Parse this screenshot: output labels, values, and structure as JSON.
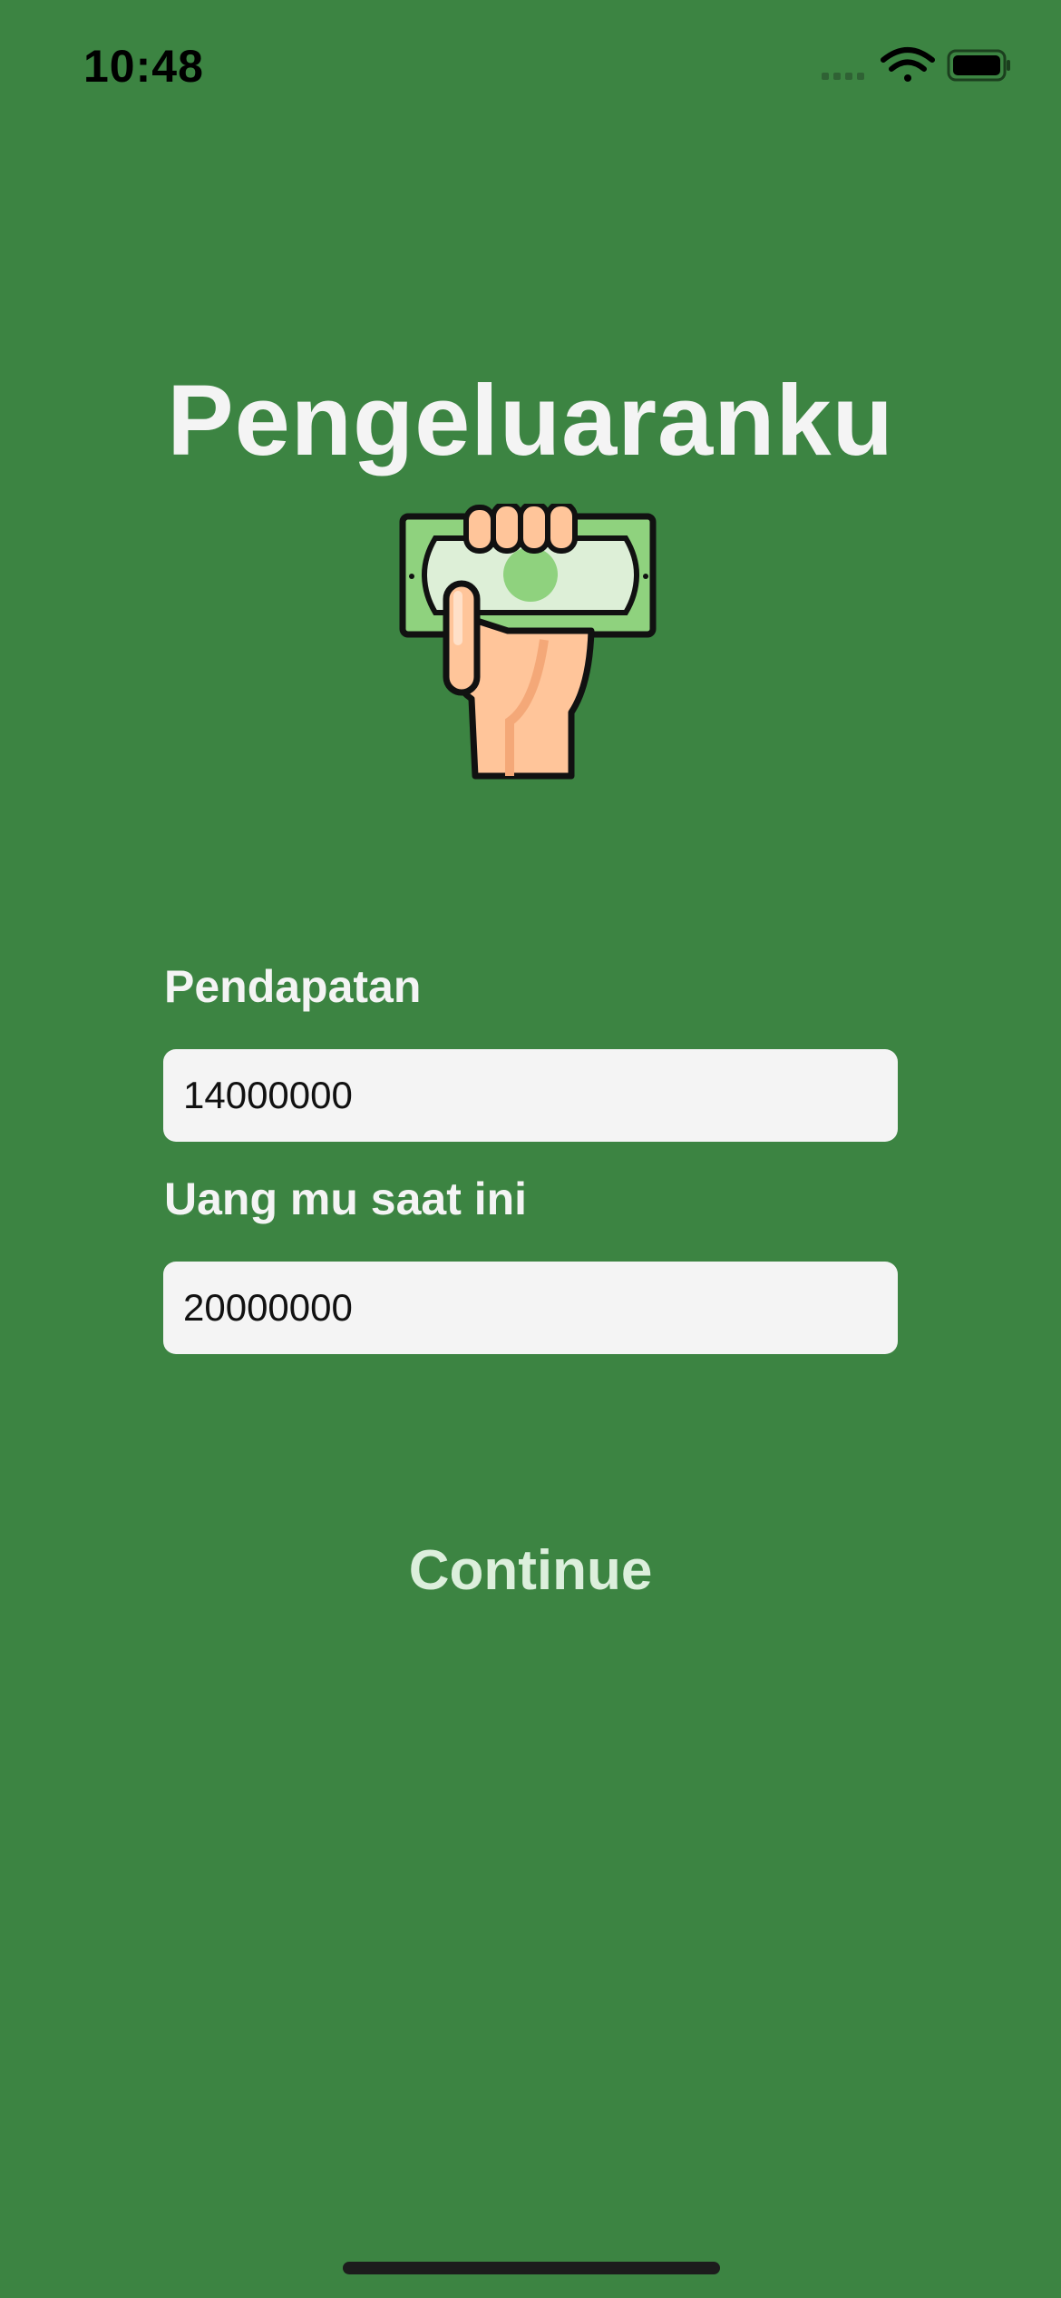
{
  "status_bar": {
    "time": "10:48"
  },
  "app": {
    "title": "Pengeluaranku",
    "logo_icon": "hand-holding-cash-icon"
  },
  "form": {
    "income": {
      "label": "Pendapatan",
      "value": "14000000"
    },
    "current_money": {
      "label": "Uang mu saat ini",
      "value": "20000000"
    },
    "continue_label": "Continue"
  },
  "colors": {
    "background": "#3c8442",
    "field_background": "#f4f4f4",
    "title_text": "#f4f4f4",
    "button_text": "#dcefdc"
  }
}
